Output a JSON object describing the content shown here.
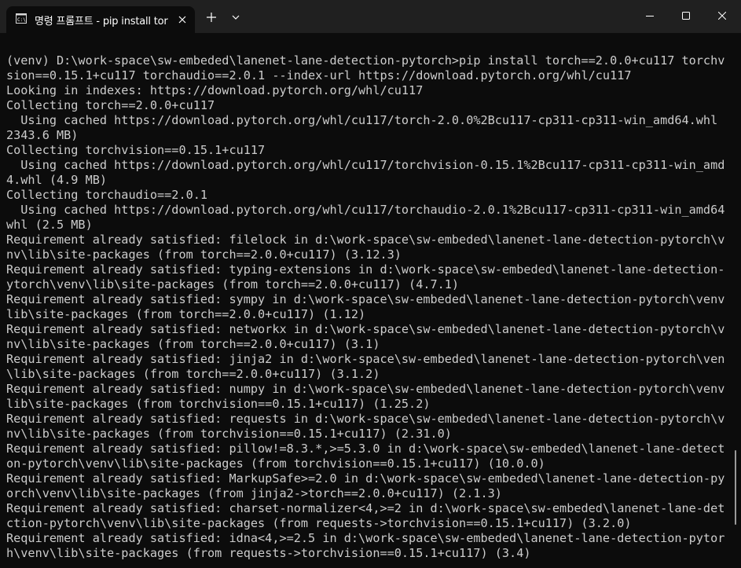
{
  "titlebar": {
    "tab_title": "명령 프롬프트 - pip  install tor",
    "icons": {
      "tab_icon": "console-icon",
      "tab_close": "close-icon",
      "new_tab": "plus-icon",
      "dropdown": "chevron-down-icon",
      "minimize": "minimize-icon",
      "maximize": "maximize-icon",
      "close": "close-icon"
    }
  },
  "colors": {
    "terminal_bg": "#0c0c0c",
    "terminal_fg": "#cccccc",
    "titlebar_bg": "#202020",
    "scrollbar": "#9a9a9a"
  },
  "terminal": {
    "lines": [
      "(venv) D:\\work-space\\sw-embeded\\lanenet-lane-detection-pytorch>pip install torch==2.0.0+cu117 torchvi",
      "sion==0.15.1+cu117 torchaudio==2.0.1 --index-url https://download.pytorch.org/whl/cu117",
      "Looking in indexes: https://download.pytorch.org/whl/cu117",
      "Collecting torch==2.0.0+cu117",
      "  Using cached https://download.pytorch.org/whl/cu117/torch-2.0.0%2Bcu117-cp311-cp311-win_amd64.whl (",
      "2343.6 MB)",
      "Collecting torchvision==0.15.1+cu117",
      "  Using cached https://download.pytorch.org/whl/cu117/torchvision-0.15.1%2Bcu117-cp311-cp311-win_amd6",
      "4.whl (4.9 MB)",
      "Collecting torchaudio==2.0.1",
      "  Using cached https://download.pytorch.org/whl/cu117/torchaudio-2.0.1%2Bcu117-cp311-cp311-win_amd64.",
      "whl (2.5 MB)",
      "Requirement already satisfied: filelock in d:\\work-space\\sw-embeded\\lanenet-lane-detection-pytorch\\ve",
      "nv\\lib\\site-packages (from torch==2.0.0+cu117) (3.12.3)",
      "Requirement already satisfied: typing-extensions in d:\\work-space\\sw-embeded\\lanenet-lane-detection-p",
      "ytorch\\venv\\lib\\site-packages (from torch==2.0.0+cu117) (4.7.1)",
      "Requirement already satisfied: sympy in d:\\work-space\\sw-embeded\\lanenet-lane-detection-pytorch\\venv\\",
      "lib\\site-packages (from torch==2.0.0+cu117) (1.12)",
      "Requirement already satisfied: networkx in d:\\work-space\\sw-embeded\\lanenet-lane-detection-pytorch\\ve",
      "nv\\lib\\site-packages (from torch==2.0.0+cu117) (3.1)",
      "Requirement already satisfied: jinja2 in d:\\work-space\\sw-embeded\\lanenet-lane-detection-pytorch\\venv",
      "\\lib\\site-packages (from torch==2.0.0+cu117) (3.1.2)",
      "Requirement already satisfied: numpy in d:\\work-space\\sw-embeded\\lanenet-lane-detection-pytorch\\venv\\",
      "lib\\site-packages (from torchvision==0.15.1+cu117) (1.25.2)",
      "Requirement already satisfied: requests in d:\\work-space\\sw-embeded\\lanenet-lane-detection-pytorch\\ve",
      "nv\\lib\\site-packages (from torchvision==0.15.1+cu117) (2.31.0)",
      "Requirement already satisfied: pillow!=8.3.*,>=5.3.0 in d:\\work-space\\sw-embeded\\lanenet-lane-detecti",
      "on-pytorch\\venv\\lib\\site-packages (from torchvision==0.15.1+cu117) (10.0.0)",
      "Requirement already satisfied: MarkupSafe>=2.0 in d:\\work-space\\sw-embeded\\lanenet-lane-detection-pyt",
      "orch\\venv\\lib\\site-packages (from jinja2->torch==2.0.0+cu117) (2.1.3)",
      "Requirement already satisfied: charset-normalizer<4,>=2 in d:\\work-space\\sw-embeded\\lanenet-lane-dete",
      "ction-pytorch\\venv\\lib\\site-packages (from requests->torchvision==0.15.1+cu117) (3.2.0)",
      "Requirement already satisfied: idna<4,>=2.5 in d:\\work-space\\sw-embeded\\lanenet-lane-detection-pytorc",
      "h\\venv\\lib\\site-packages (from requests->torchvision==0.15.1+cu117) (3.4)"
    ]
  }
}
